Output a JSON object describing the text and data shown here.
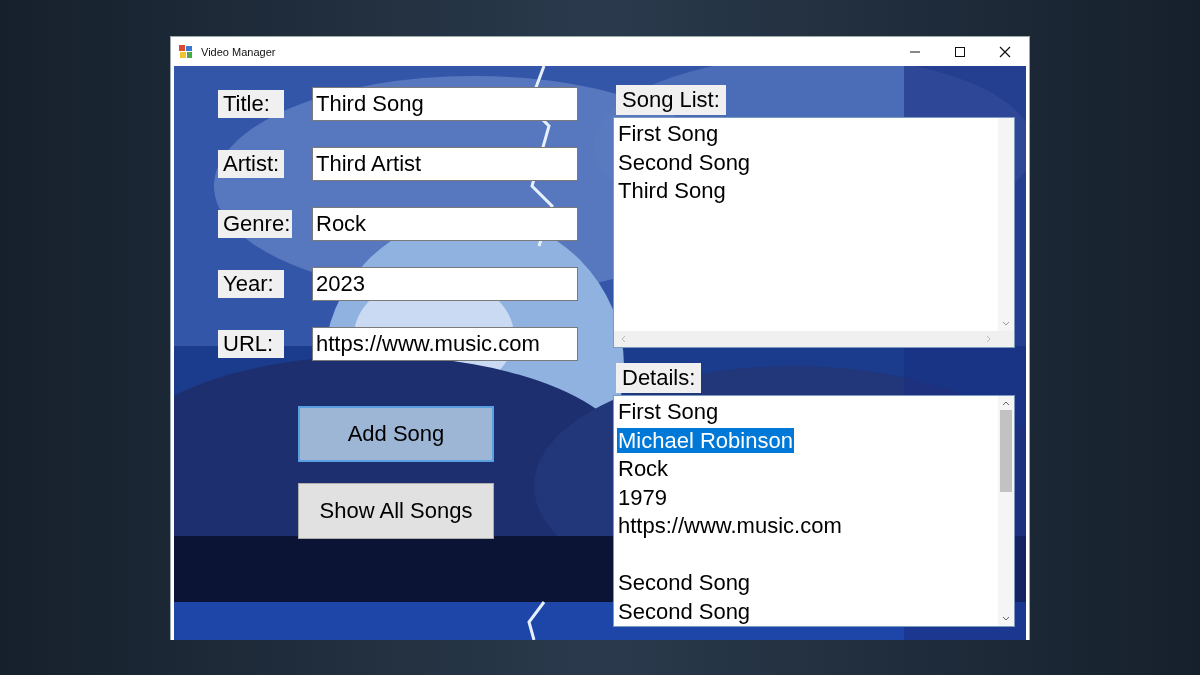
{
  "window": {
    "title": "Video Manager"
  },
  "form": {
    "fields": [
      {
        "label": "Title:",
        "value": "Third Song"
      },
      {
        "label": "Artist:",
        "value": "Third Artist"
      },
      {
        "label": "Genre:",
        "value": "Rock"
      },
      {
        "label": "Year:",
        "value": "2023"
      },
      {
        "label": "URL:",
        "value": "https://www.music.com"
      }
    ],
    "buttons": [
      {
        "label": "Add Song",
        "focused": true
      },
      {
        "label": "Show All Songs",
        "focused": false
      }
    ]
  },
  "song_list": {
    "label": "Song List:",
    "items": [
      {
        "text": "First Song",
        "selected": false
      },
      {
        "text": "Second Song",
        "selected": false
      },
      {
        "text": "Third Song",
        "selected": false
      }
    ]
  },
  "details": {
    "label": "Details:",
    "items": [
      {
        "kind": "text",
        "text": "First Song",
        "selected": false
      },
      {
        "kind": "text",
        "text": "Michael Robinson",
        "selected": true
      },
      {
        "kind": "text",
        "text": "Rock",
        "selected": false
      },
      {
        "kind": "text",
        "text": "1979",
        "selected": false
      },
      {
        "kind": "text",
        "text": "https://www.music.com",
        "selected": false
      },
      {
        "kind": "blank"
      },
      {
        "kind": "text",
        "text": "Second Song",
        "selected": false
      },
      {
        "kind": "text",
        "text": "Second Song",
        "selected": false
      }
    ]
  }
}
